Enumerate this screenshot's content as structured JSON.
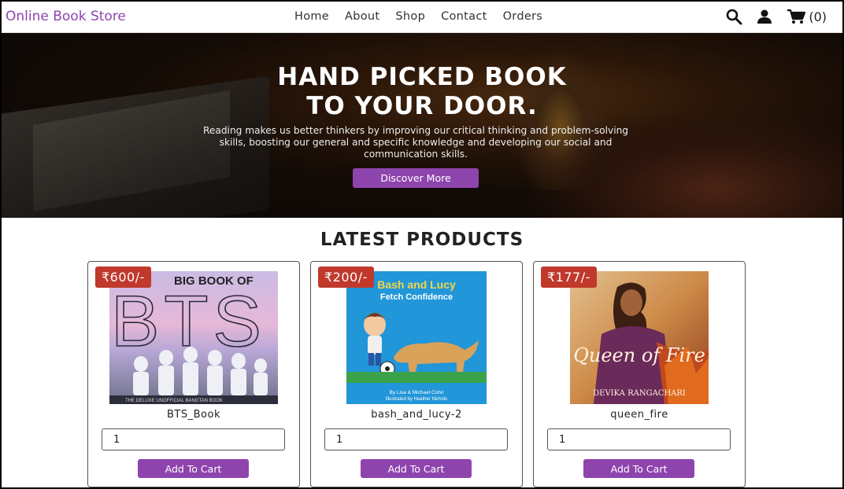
{
  "header": {
    "logo": "Online Book Store",
    "nav": [
      "Home",
      "About",
      "Shop",
      "Contact",
      "Orders"
    ],
    "icons": [
      "search-icon",
      "user-icon",
      "cart-icon"
    ],
    "cart_count": "(0)"
  },
  "hero": {
    "title_line1": "HAND PICKED BOOK",
    "title_line2": "TO YOUR DOOR.",
    "description": "Reading makes us better thinkers by improving our critical thinking and problem-solving skills, boosting our general and specific knowledge and developing our social and communication skills.",
    "button": "Discover More"
  },
  "products": {
    "title": "LATEST PRODUCTS",
    "add_label": "Add To Cart",
    "items": [
      {
        "price": "₹600/-",
        "name": "BTS_Book",
        "qty": "1",
        "cover_title": "BIG BOOK OF",
        "cover_big": "BTS",
        "cover_sub": "THE DELUXE UNOFFICIAL BANGTAN BOOK"
      },
      {
        "price": "₹200/-",
        "name": "bash_and_lucy-2",
        "qty": "1",
        "cover_title": "Bash and Lucy",
        "cover_sub": "Fetch Confidence",
        "cover_credit": "By Lisa & Michael Cohn",
        "cover_credit2": "Illustrated by Heather Nichols"
      },
      {
        "price": "₹177/-",
        "name": "queen_fire",
        "qty": "1",
        "cover_title": "Queen of Fire",
        "cover_author": "DEVIKA RANGACHARI"
      }
    ]
  },
  "colors": {
    "accent": "#8e44ad",
    "price_badge": "#c0392b"
  }
}
